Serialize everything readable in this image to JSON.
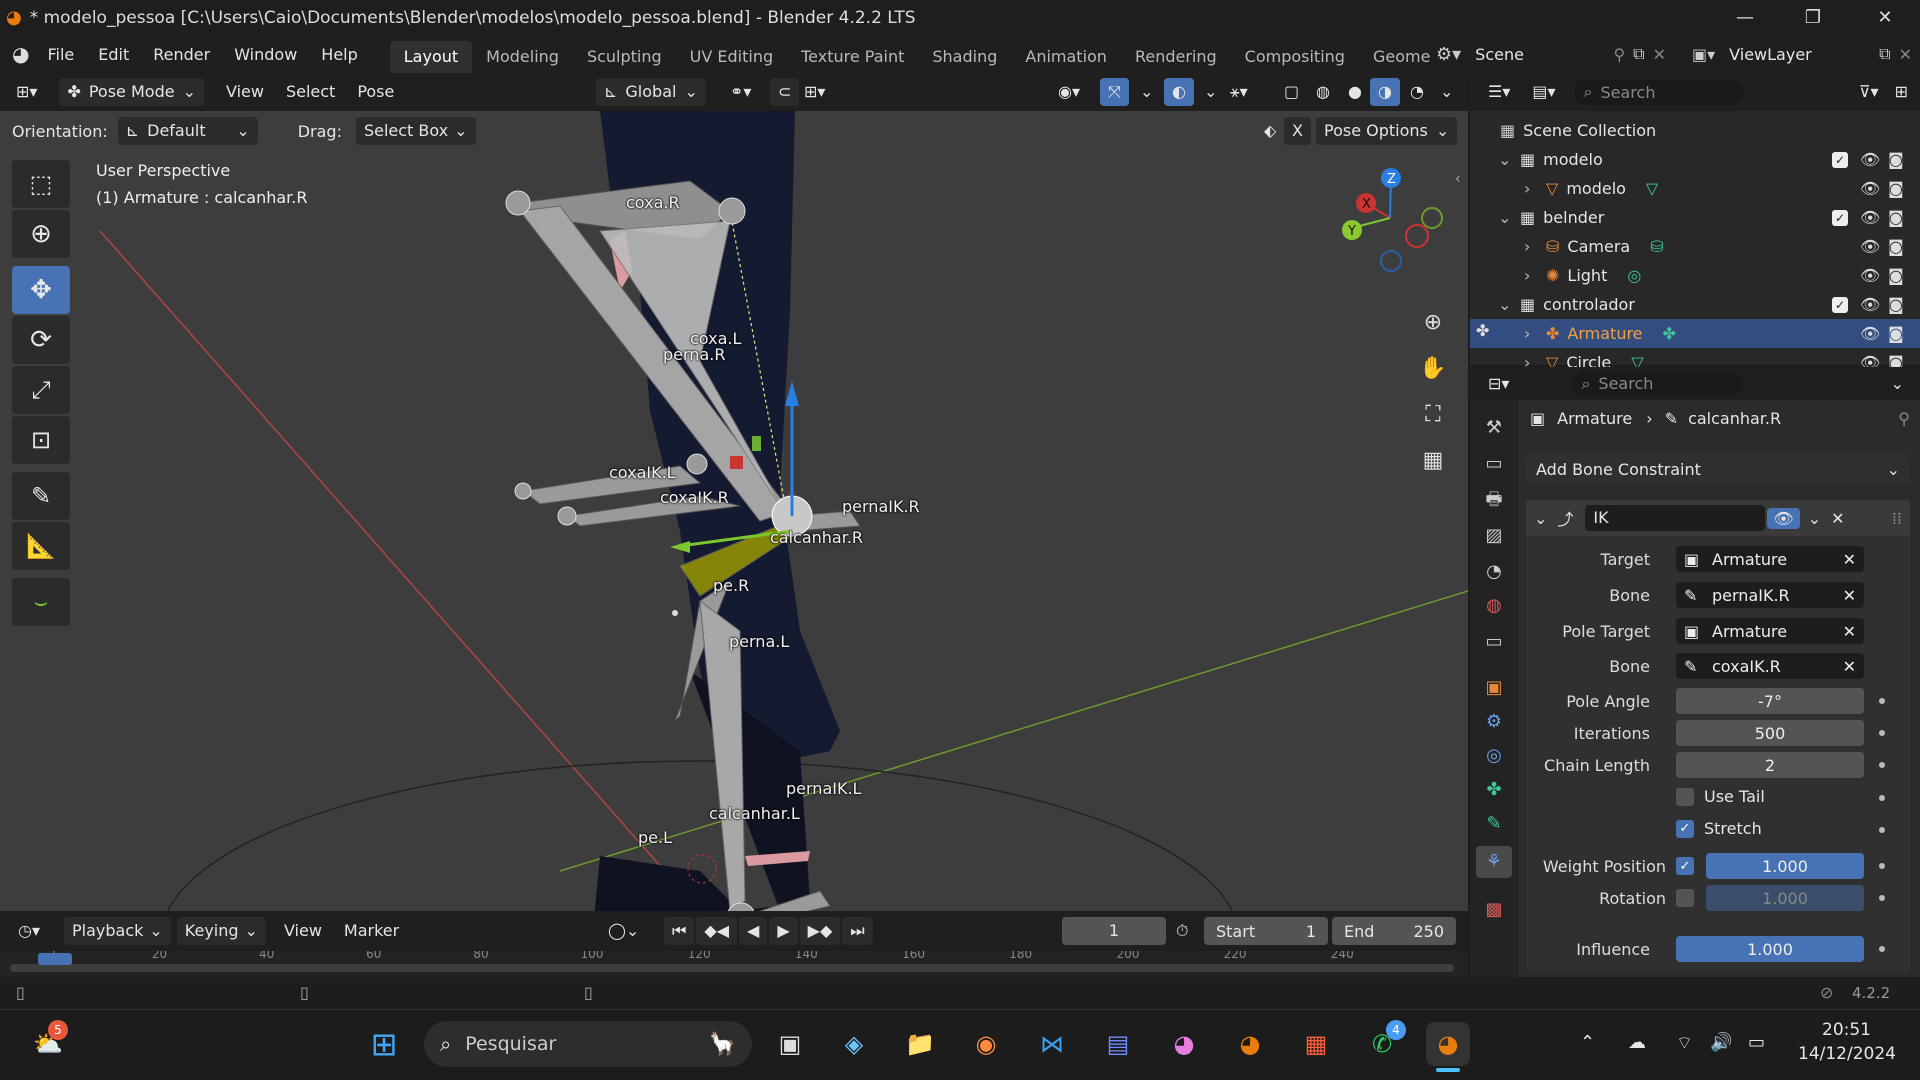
{
  "window": {
    "title": "* modelo_pessoa [C:\\Users\\Caio\\Documents\\Blender\\modelos\\modelo_pessoa.blend] - Blender 4.2.2 LTS",
    "minimize": "—",
    "maximize": "❐",
    "close": "✕"
  },
  "menu": {
    "items": [
      "File",
      "Edit",
      "Render",
      "Window",
      "Help"
    ]
  },
  "workspaces": {
    "tabs": [
      "Layout",
      "Modeling",
      "Sculpting",
      "UV Editing",
      "Texture Paint",
      "Shading",
      "Animation",
      "Rendering",
      "Compositing",
      "Geome"
    ],
    "active": "Layout"
  },
  "scene": {
    "name": "Scene",
    "view_layer": "ViewLayer"
  },
  "viewport_header": {
    "mode": "Pose Mode",
    "menus": [
      "View",
      "Select",
      "Pose"
    ],
    "transform_orientation": "Global"
  },
  "tool_header": {
    "orientation_label": "Orientation:",
    "orientation_value": "Default",
    "drag_label": "Drag:",
    "drag_value": "Select Box",
    "pose_options": "Pose Options",
    "x_axis": "X"
  },
  "viewport": {
    "line1": "User Perspective",
    "line2": "(1) Armature : calcanhar.R",
    "gizmo": {
      "z": "Z",
      "x": "X",
      "y": "Y"
    }
  },
  "bones": [
    "coxa.R",
    "coxa.L",
    "perna.R",
    "coxaIK.L",
    "coxaIK.R",
    "pernaIK.R",
    "calcanhar.R",
    "pe.R",
    "perna.L",
    "pernaIK.L",
    "calcanhar.L",
    "pe.L"
  ],
  "timeline": {
    "menus": [
      "Playback",
      "Keying",
      "View",
      "Marker"
    ],
    "current_frame": "1",
    "start_label": "Start",
    "start": "1",
    "end_label": "End",
    "end": "250",
    "ticks": [
      "1",
      "20",
      "40",
      "60",
      "80",
      "100",
      "120",
      "140",
      "160",
      "180",
      "200",
      "220",
      "240"
    ]
  },
  "status": {
    "version": "4.2.2"
  },
  "outliner": {
    "search_placeholder": "Search",
    "root": "Scene Collection",
    "rows": [
      {
        "label": "modelo",
        "type": "collection",
        "indent": 1
      },
      {
        "label": "modelo",
        "type": "mesh",
        "indent": 2
      },
      {
        "label": "belnder",
        "type": "collection",
        "indent": 1
      },
      {
        "label": "Camera",
        "type": "camera",
        "indent": 2
      },
      {
        "label": "Light",
        "type": "light",
        "indent": 2
      },
      {
        "label": "controlador",
        "type": "collection",
        "indent": 1
      },
      {
        "label": "Armature",
        "type": "armature",
        "indent": 2,
        "selected": true
      },
      {
        "label": "Circle",
        "type": "curve",
        "indent": 2
      }
    ]
  },
  "properties": {
    "search_placeholder": "Search",
    "breadcrumb_object": "Armature",
    "breadcrumb_bone": "calcanhar.R",
    "add_constraint": "Add Bone Constraint",
    "constraint_name": "IK",
    "fields": {
      "target_label": "Target",
      "target": "Armature",
      "bone_label": "Bone",
      "bone": "pernaIK.R",
      "pole_target_label": "Pole Target",
      "pole_target": "Armature",
      "pole_bone_label": "Bone",
      "pole_bone": "coxaIK.R",
      "pole_angle_label": "Pole Angle",
      "pole_angle": "-7°",
      "iterations_label": "Iterations",
      "iterations": "500",
      "chain_length_label": "Chain Length",
      "chain_length": "2",
      "use_tail_label": "Use Tail",
      "use_tail": false,
      "stretch_label": "Stretch",
      "stretch": true,
      "weight_position_label": "Weight Position",
      "weight_position": "1.000",
      "weight_position_enabled": true,
      "rotation_label": "Rotation",
      "rotation": "1.000",
      "rotation_enabled": false,
      "influence_label": "Influence",
      "influence": "1.000"
    }
  },
  "taskbar": {
    "search_placeholder": "Pesquisar",
    "time": "20:51",
    "date": "14/12/2024",
    "weather_badge": "5",
    "whatsapp_badge": "4"
  },
  "colors": {
    "accent": "#4772b3",
    "selected_row": "#334d80",
    "armature_orange": "#e8883a",
    "viewport_bg": "#3d3d3d"
  }
}
